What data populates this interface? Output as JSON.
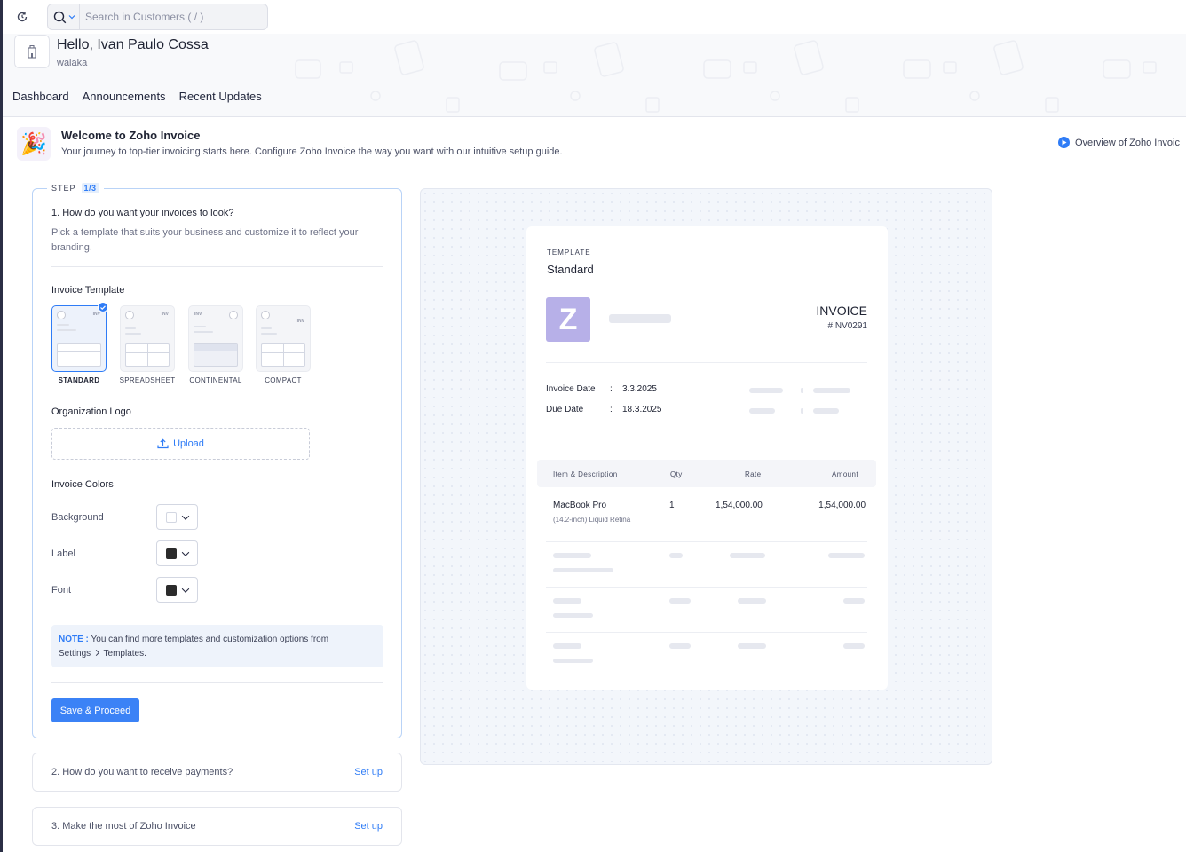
{
  "topbar": {
    "recent_icon": "refresh-clock-icon",
    "search_placeholder": "Search in Customers ( / )"
  },
  "header": {
    "greeting": "Hello, Ivan Paulo Cossa",
    "org_name": "walaka",
    "nav": [
      "Dashboard",
      "Announcements",
      "Recent Updates"
    ]
  },
  "welcome": {
    "title": "Welcome to Zoho Invoice",
    "subtitle": "Your journey to top-tier invoicing starts here. Configure Zoho Invoice the way you want with our intuitive setup guide.",
    "overview_link": "Overview of Zoho Invoic"
  },
  "step": {
    "tag_label": "STEP",
    "tag_count": "1/3",
    "question": "1. How do you want your invoices to look?",
    "description": "Pick a template that suits your business and customize it to reflect your branding.",
    "template_label": "Invoice Template",
    "templates": [
      "STANDARD",
      "SPREADSHEET",
      "CONTINENTAL",
      "COMPACT"
    ],
    "selected_template": "STANDARD",
    "template_badge": "INV",
    "logo_label": "Organization Logo",
    "upload_label": "Upload",
    "colors_label": "Invoice Colors",
    "colors": [
      {
        "label": "Background",
        "value": "#ffffff"
      },
      {
        "label": "Label",
        "value": "#2b2b2b"
      },
      {
        "label": "Font",
        "value": "#2b2b2b"
      }
    ],
    "note_key": "NOTE :",
    "note_text": "You can find more templates and customization options from",
    "note_path_1": "Settings",
    "note_path_2": "Templates.",
    "save_label": "Save & Proceed"
  },
  "next_steps": [
    {
      "title": "2. How do you want to receive payments?",
      "action": "Set up"
    },
    {
      "title": "3. Make the most of Zoho Invoice",
      "action": "Set up"
    }
  ],
  "preview": {
    "template_caption": "TEMPLATE",
    "template_name": "Standard",
    "logo_letter": "Z",
    "doc_title": "INVOICE",
    "doc_number": "#INV0291",
    "invoice_date_label": "Invoice Date",
    "invoice_date": "3.3.2025",
    "due_date_label": "Due Date",
    "due_date": "18.3.2025",
    "separator": ":",
    "columns": [
      "Item & Description",
      "Qty",
      "Rate",
      "Amount"
    ],
    "item": {
      "name": "MacBook Pro",
      "desc": "(14.2-inch) Liquid Retina",
      "qty": "1",
      "rate": "1,54,000.00",
      "amount": "1,54,000.00"
    }
  },
  "colors": {
    "accent": "#2f7cf6",
    "step_border": "#b9d3f7",
    "logo_bg": "#b7b0e8"
  }
}
